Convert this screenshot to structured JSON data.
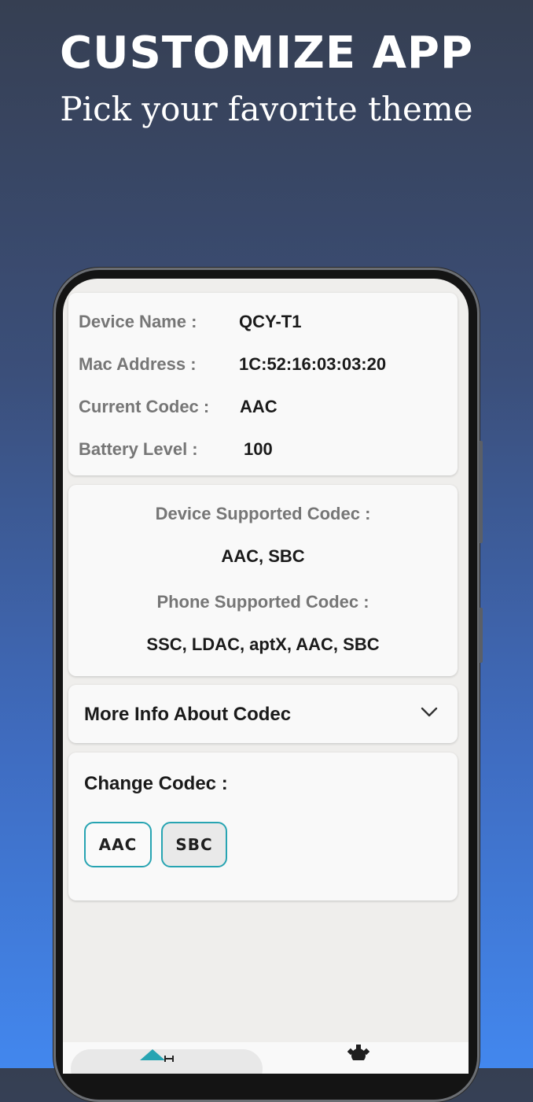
{
  "promo": {
    "title": "CUSTOMIZE APP",
    "subtitle": "Pick your favorite theme"
  },
  "device_info": {
    "rows": [
      {
        "label": "Device Name   :",
        "value": "QCY-T1"
      },
      {
        "label": "Mac Address   :",
        "value": "1C:52:16:03:03:20"
      },
      {
        "label": "Current Codec :",
        "value": "AAC"
      },
      {
        "label": "Battery Level   :",
        "value": "100"
      }
    ]
  },
  "supported": {
    "device_label": "Device Supported Codec :",
    "device_value": "AAC, SBC",
    "phone_label": "Phone Supported Codec :",
    "phone_value": "SSC, LDAC, aptX, AAC, SBC"
  },
  "more_info": {
    "label": "More Info About Codec",
    "icon": "chevron-down-icon"
  },
  "change_codec": {
    "title": "Change Codec :",
    "options": [
      "AAC",
      "SBC"
    ],
    "selected": "SBC"
  },
  "nav": {
    "items": [
      {
        "icon": "home-icon"
      },
      {
        "icon": "gear-icon"
      }
    ]
  },
  "colors": {
    "accent": "#27a4b2",
    "background_top": "#363f52",
    "background_bottom": "#4287ee"
  }
}
